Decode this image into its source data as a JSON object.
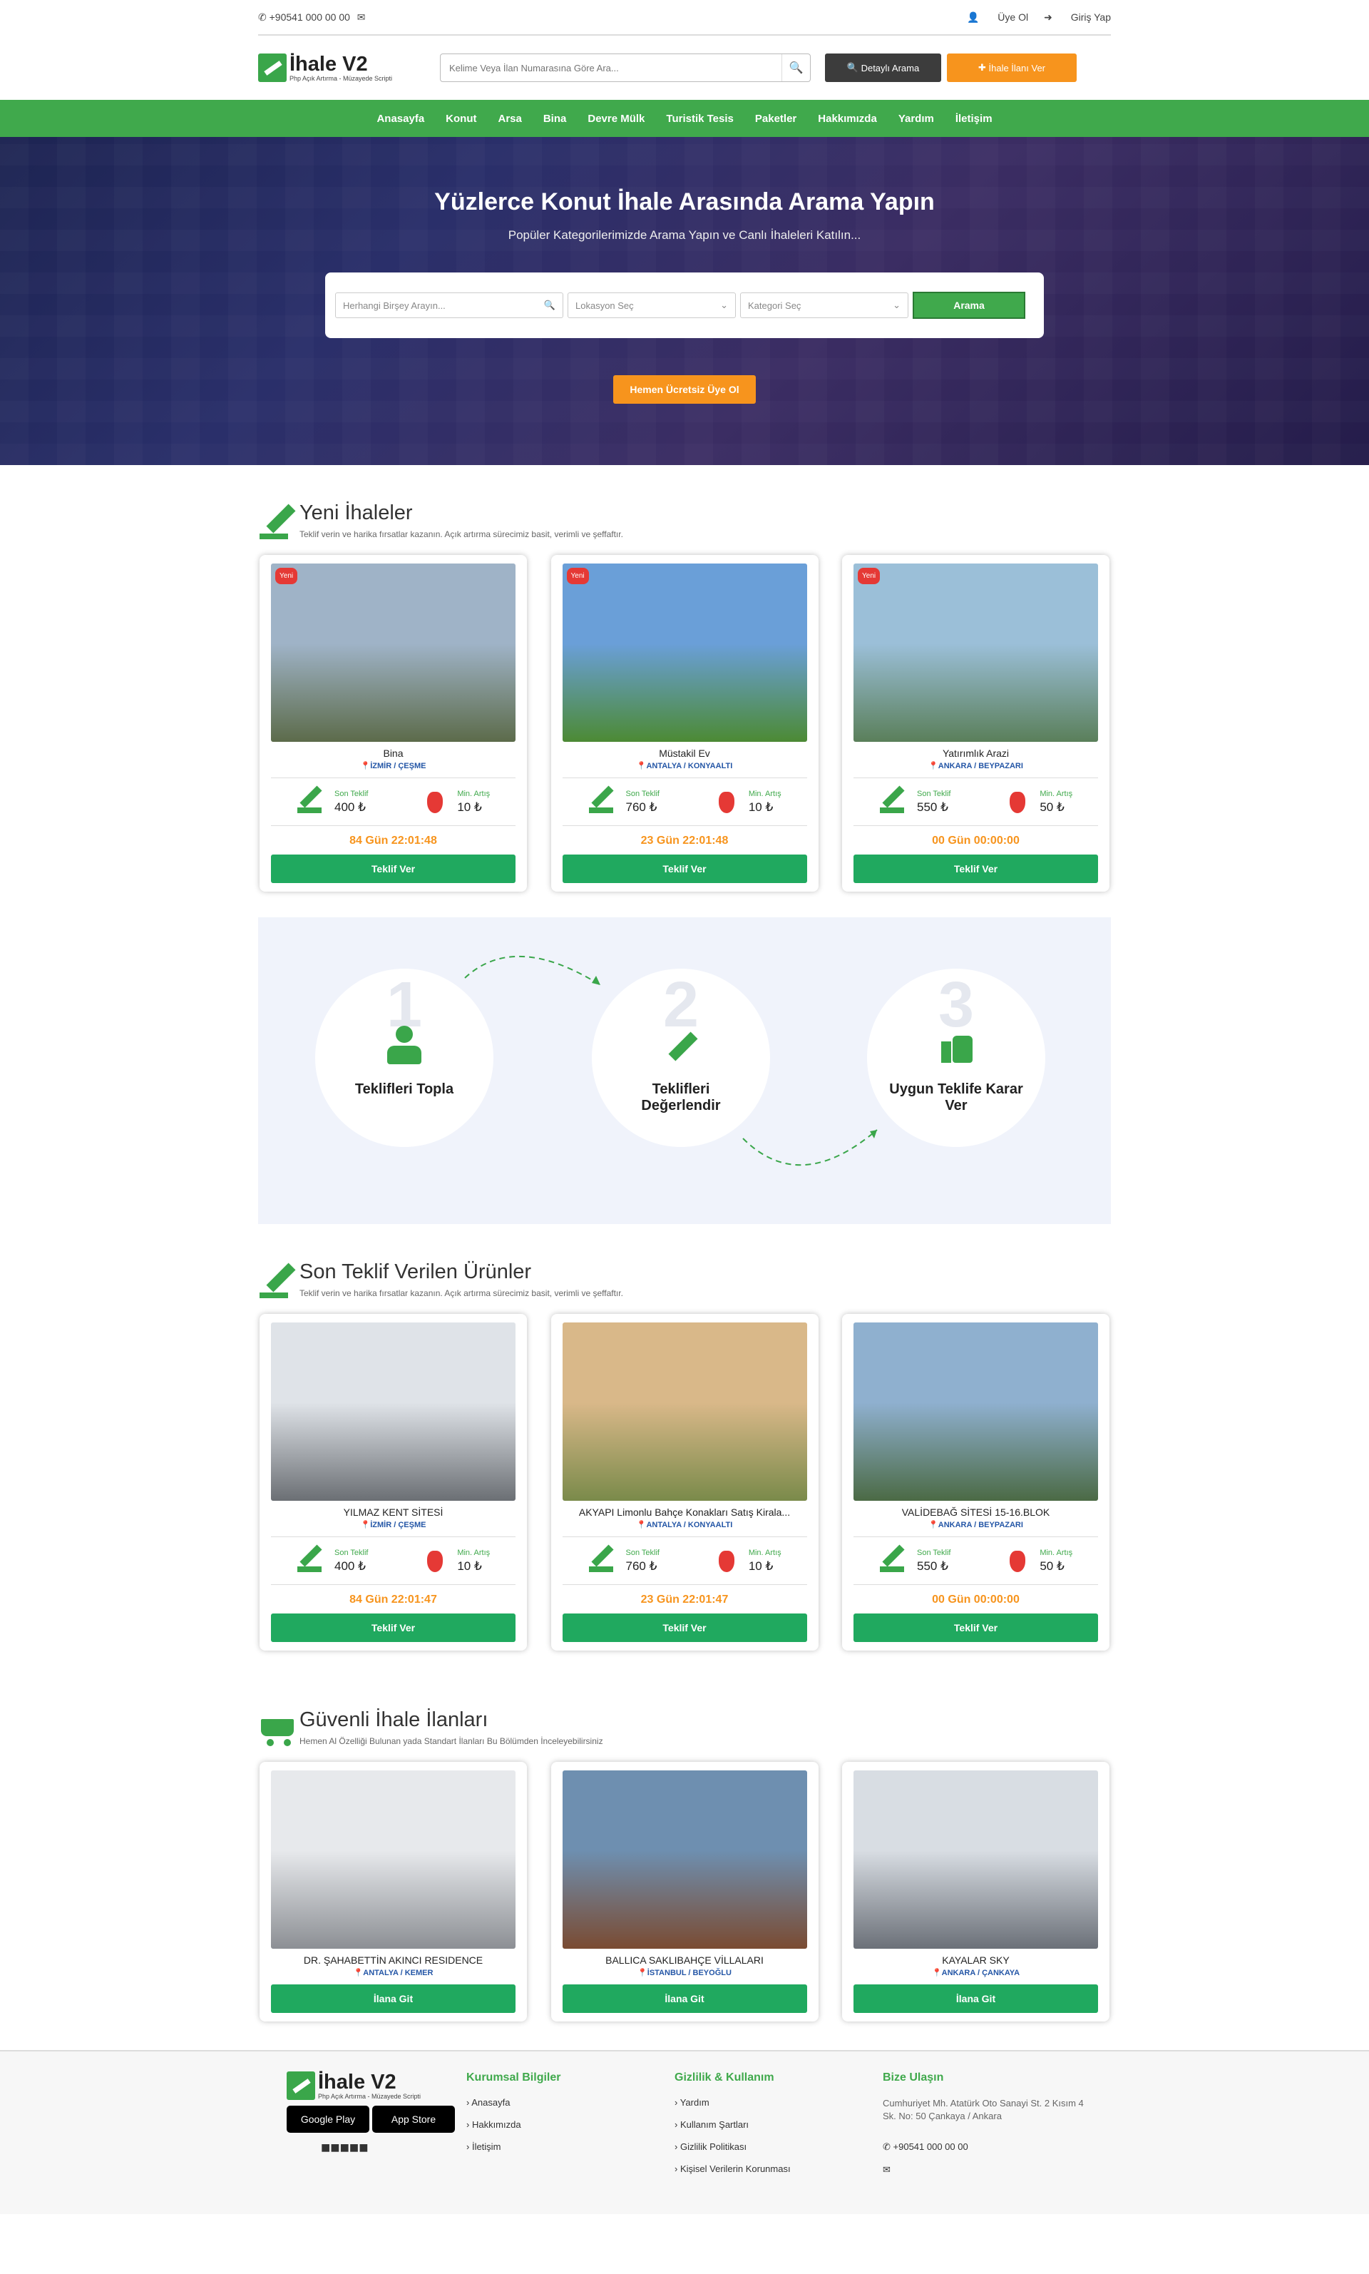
{
  "topbar": {
    "phone": "+90541 000 00 00",
    "register": "Üye Ol",
    "login": "Giriş Yap"
  },
  "header": {
    "logo_main": "İhale V2",
    "logo_sub": "Php Açık Artırma - Müzayede Scripti",
    "search_placeholder": "Kelime Veya İlan Numarasına Göre Ara...",
    "detailed": "Detaylı Arama",
    "post": "İhale İlanı Ver"
  },
  "nav": [
    "Anasayfa",
    "Konut",
    "Arsa",
    "Bina",
    "Devre Mülk",
    "Turistik Tesis",
    "Paketler",
    "Hakkımızda",
    "Yardım",
    "İletişim"
  ],
  "hero": {
    "title": "Yüzlerce Konut İhale Arasında Arama Yapın",
    "subtitle": "Popüler Kategorilerimizde Arama Yapın ve Canlı İhaleleri Katılın...",
    "q_placeholder": "Herhangi Birşey Arayın...",
    "location": "Lokasyon Seç",
    "category": "Kategori Seç",
    "search": "Arama",
    "register": "Hemen Ücretsiz Üye Ol"
  },
  "labels": {
    "last_bid": "Son Teklif",
    "min_inc": "Min. Artış",
    "bid_btn": "Teklif Ver",
    "go_btn": "İlana Git",
    "new": "Yeni"
  },
  "new_section": {
    "title": "Yeni İhaleler",
    "desc": "Teklif verin ve harika fırsatlar kazanın. Açık artırma sürecimiz basit, verimli ve şeffaftır.",
    "cards": [
      {
        "title": "Bina",
        "loc": "İZMİR / ÇEŞME",
        "last": "400 ₺",
        "min": "10 ₺",
        "time": "84 Gün 22:01:48",
        "c1": "#9fb3c7",
        "c2": "#5c6b4a"
      },
      {
        "title": "Müstakil Ev",
        "loc": "ANTALYA / KONYAALTI",
        "last": "760 ₺",
        "min": "10 ₺",
        "time": "23 Gün 22:01:48",
        "c1": "#6a9fd8",
        "c2": "#4c8a34"
      },
      {
        "title": "Yatırımlık Arazi",
        "loc": "ANKARA / BEYPAZARI",
        "last": "550 ₺",
        "min": "50 ₺",
        "time": "00 Gün 00:00:00",
        "c1": "#9bbfd8",
        "c2": "#5a7f5a"
      }
    ]
  },
  "steps": [
    {
      "num": "1",
      "label": "Teklifleri Topla"
    },
    {
      "num": "2",
      "label": "Teklifleri Değerlendir"
    },
    {
      "num": "3",
      "label": "Uygun Teklife Karar Ver"
    }
  ],
  "last_section": {
    "title": "Son Teklif Verilen Ürünler",
    "desc": "Teklif verin ve harika fırsatlar kazanın. Açık artırma sürecimiz basit, verimli ve şeffaftır.",
    "cards": [
      {
        "title": "YILMAZ KENT SİTESİ",
        "loc": "İZMİR / ÇEŞME",
        "last": "400 ₺",
        "min": "10 ₺",
        "time": "84 Gün 22:01:47",
        "c1": "#dfe3e8",
        "c2": "#6b6f74"
      },
      {
        "title": "AKYAPI Limonlu Bahçe Konakları Satış Kirala...",
        "loc": "ANTALYA / KONYAALTI",
        "last": "760 ₺",
        "min": "10 ₺",
        "time": "23 Gün 22:01:47",
        "c1": "#d9b889",
        "c2": "#7a8a4a"
      },
      {
        "title": "VALİDEBAĞ SİTESİ 15-16.BLOK",
        "loc": "ANKARA / BEYPAZARI",
        "last": "550 ₺",
        "min": "50 ₺",
        "time": "00 Gün 00:00:00",
        "c1": "#8fb0cf",
        "c2": "#4b6a45"
      }
    ]
  },
  "safe_section": {
    "title": "Güvenli İhale İlanları",
    "desc": "Hemen Al Özelliği Bulunan yada Standart İlanları Bu Bölümden İnceleyebilirsiniz",
    "cards": [
      {
        "title": "DR. ŞAHABETTİN AKINCI RESIDENCE",
        "loc": "ANTALYA / KEMER",
        "c1": "#e7e9ec",
        "c2": "#8c8f94"
      },
      {
        "title": "BALLICA SAKLIBAHÇE VİLLALARI",
        "loc": "İSTANBUL / BEYOĞLU",
        "c1": "#6e8fb0",
        "c2": "#7a4b32"
      },
      {
        "title": "KAYALAR SKY",
        "loc": "ANKARA / ÇANKAYA",
        "c1": "#d8dde3",
        "c2": "#6b7078"
      }
    ]
  },
  "footer": {
    "logo_main": "İhale V2",
    "logo_sub": "Php Açık Artırma - Müzayede Scripti",
    "google": "Google Play",
    "apple": "App Store",
    "col1": {
      "title": "Kurumsal Bilgiler",
      "items": [
        "Anasayfa",
        "Hakkımızda",
        "İletişim"
      ]
    },
    "col2": {
      "title": "Gizlilik & Kullanım",
      "items": [
        "Yardım",
        "Kullanım Şartları",
        "Gizlilik Politikası",
        "Kişisel Verilerin Korunması"
      ]
    },
    "col3": {
      "title": "Bize Ulaşın",
      "address": "Cumhuriyet Mh. Atatürk Oto Sanayi St. 2 Kısım 4 Sk. No: 50 Çankaya / Ankara",
      "phone": "+90541 000 00 00"
    }
  }
}
